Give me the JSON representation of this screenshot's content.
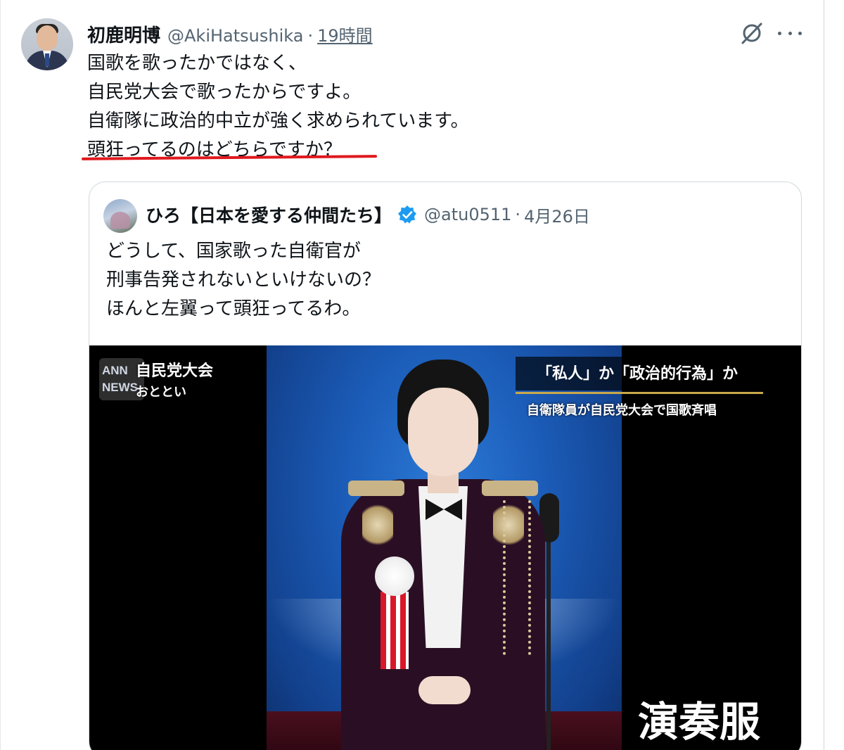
{
  "tweet": {
    "author_name": "初鹿明博",
    "author_handle": "@AkiHatsushika",
    "separator": "·",
    "time": "19時間",
    "lines": [
      "国歌を歌ったかではなく、",
      "自民党大会で歌ったからですよ。",
      "自衛隊に政治的中立が強く求められています。",
      "頭狂ってるのはどちらですか？"
    ],
    "underline_color": "#e0191e"
  },
  "quoted_tweet": {
    "author_name": "ひろ【日本を愛する仲間たち】",
    "author_handle": "@atu0511",
    "separator": "·",
    "time": "4月26日",
    "verified_color": "#1d9bf0",
    "lines": [
      "どうして、国家歌った自衛官が",
      "刑事告発されないといけないの？",
      "ほんと左翼って頭狂ってるわ。"
    ],
    "media": {
      "logo_text": "ANN NEWS",
      "overlay_title": "自民党大会",
      "overlay_sub": "おととい",
      "headline": "「私人」か「政治的行為」か",
      "caption": "自衛隊員が自民党大会で国歌斉唱",
      "bottom_label": "演奏服"
    }
  },
  "icons": [
    "grok-icon",
    "more-icon",
    "verified-icon"
  ]
}
